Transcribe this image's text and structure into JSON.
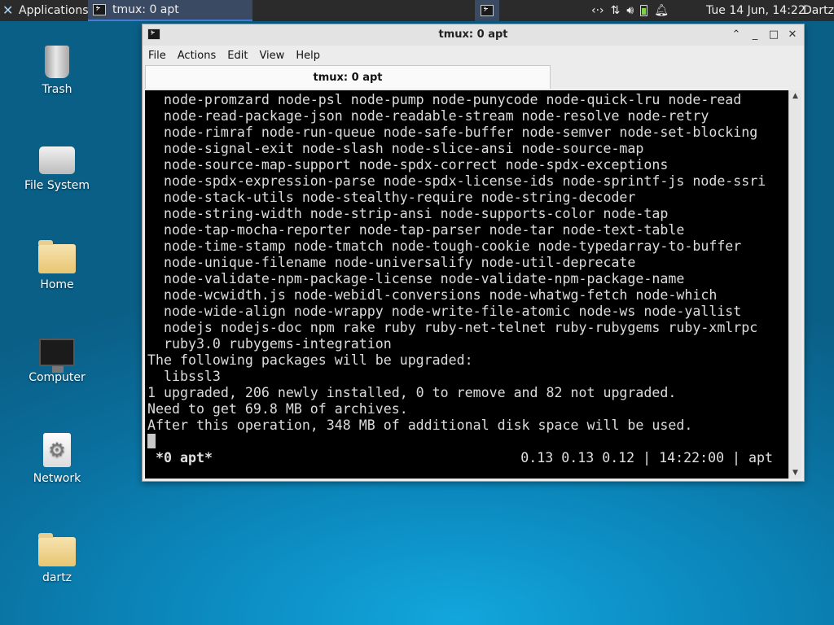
{
  "panel": {
    "applications_label": "Applications",
    "task_title": "tmux: 0 apt",
    "clock": "Tue 14 Jun, 14:22",
    "user": "Dartz"
  },
  "desktop_icons": [
    {
      "label": "Trash",
      "icon": "trash-icon"
    },
    {
      "label": "File System",
      "icon": "drive-icon"
    },
    {
      "label": "Home",
      "icon": "home-folder-icon"
    },
    {
      "label": "Computer",
      "icon": "monitor-icon"
    },
    {
      "label": "Network",
      "icon": "network-icon"
    },
    {
      "label": "dartz",
      "icon": "folder-icon"
    }
  ],
  "window": {
    "title": "tmux: 0 apt",
    "menu": [
      "File",
      "Actions",
      "Edit",
      "View",
      "Help"
    ],
    "tab_label": "tmux: 0 apt"
  },
  "terminal": {
    "lines": [
      "  node-promzard node-psl node-pump node-punycode node-quick-lru node-read",
      "  node-read-package-json node-readable-stream node-resolve node-retry",
      "  node-rimraf node-run-queue node-safe-buffer node-semver node-set-blocking",
      "  node-signal-exit node-slash node-slice-ansi node-source-map",
      "  node-source-map-support node-spdx-correct node-spdx-exceptions",
      "  node-spdx-expression-parse node-spdx-license-ids node-sprintf-js node-ssri",
      "  node-stack-utils node-stealthy-require node-string-decoder",
      "  node-string-width node-strip-ansi node-supports-color node-tap",
      "  node-tap-mocha-reporter node-tap-parser node-tar node-text-table",
      "  node-time-stamp node-tmatch node-tough-cookie node-typedarray-to-buffer",
      "  node-unique-filename node-universalify node-util-deprecate",
      "  node-validate-npm-package-license node-validate-npm-package-name",
      "  node-wcwidth.js node-webidl-conversions node-whatwg-fetch node-which",
      "  node-wide-align node-wrappy node-write-file-atomic node-ws node-yallist",
      "  nodejs nodejs-doc npm rake ruby ruby-net-telnet ruby-rubygems ruby-xmlrpc",
      "  ruby3.0 rubygems-integration",
      "The following packages will be upgraded:",
      "  libssl3",
      "1 upgraded, 206 newly installed, 0 to remove and 82 not upgraded.",
      "Need to get 69.8 MB of archives.",
      "After this operation, 348 MB of additional disk space will be used."
    ],
    "status_left": "*0 apt*",
    "status_right": "0.13 0.13 0.12 | 14:22:00 | apt"
  }
}
